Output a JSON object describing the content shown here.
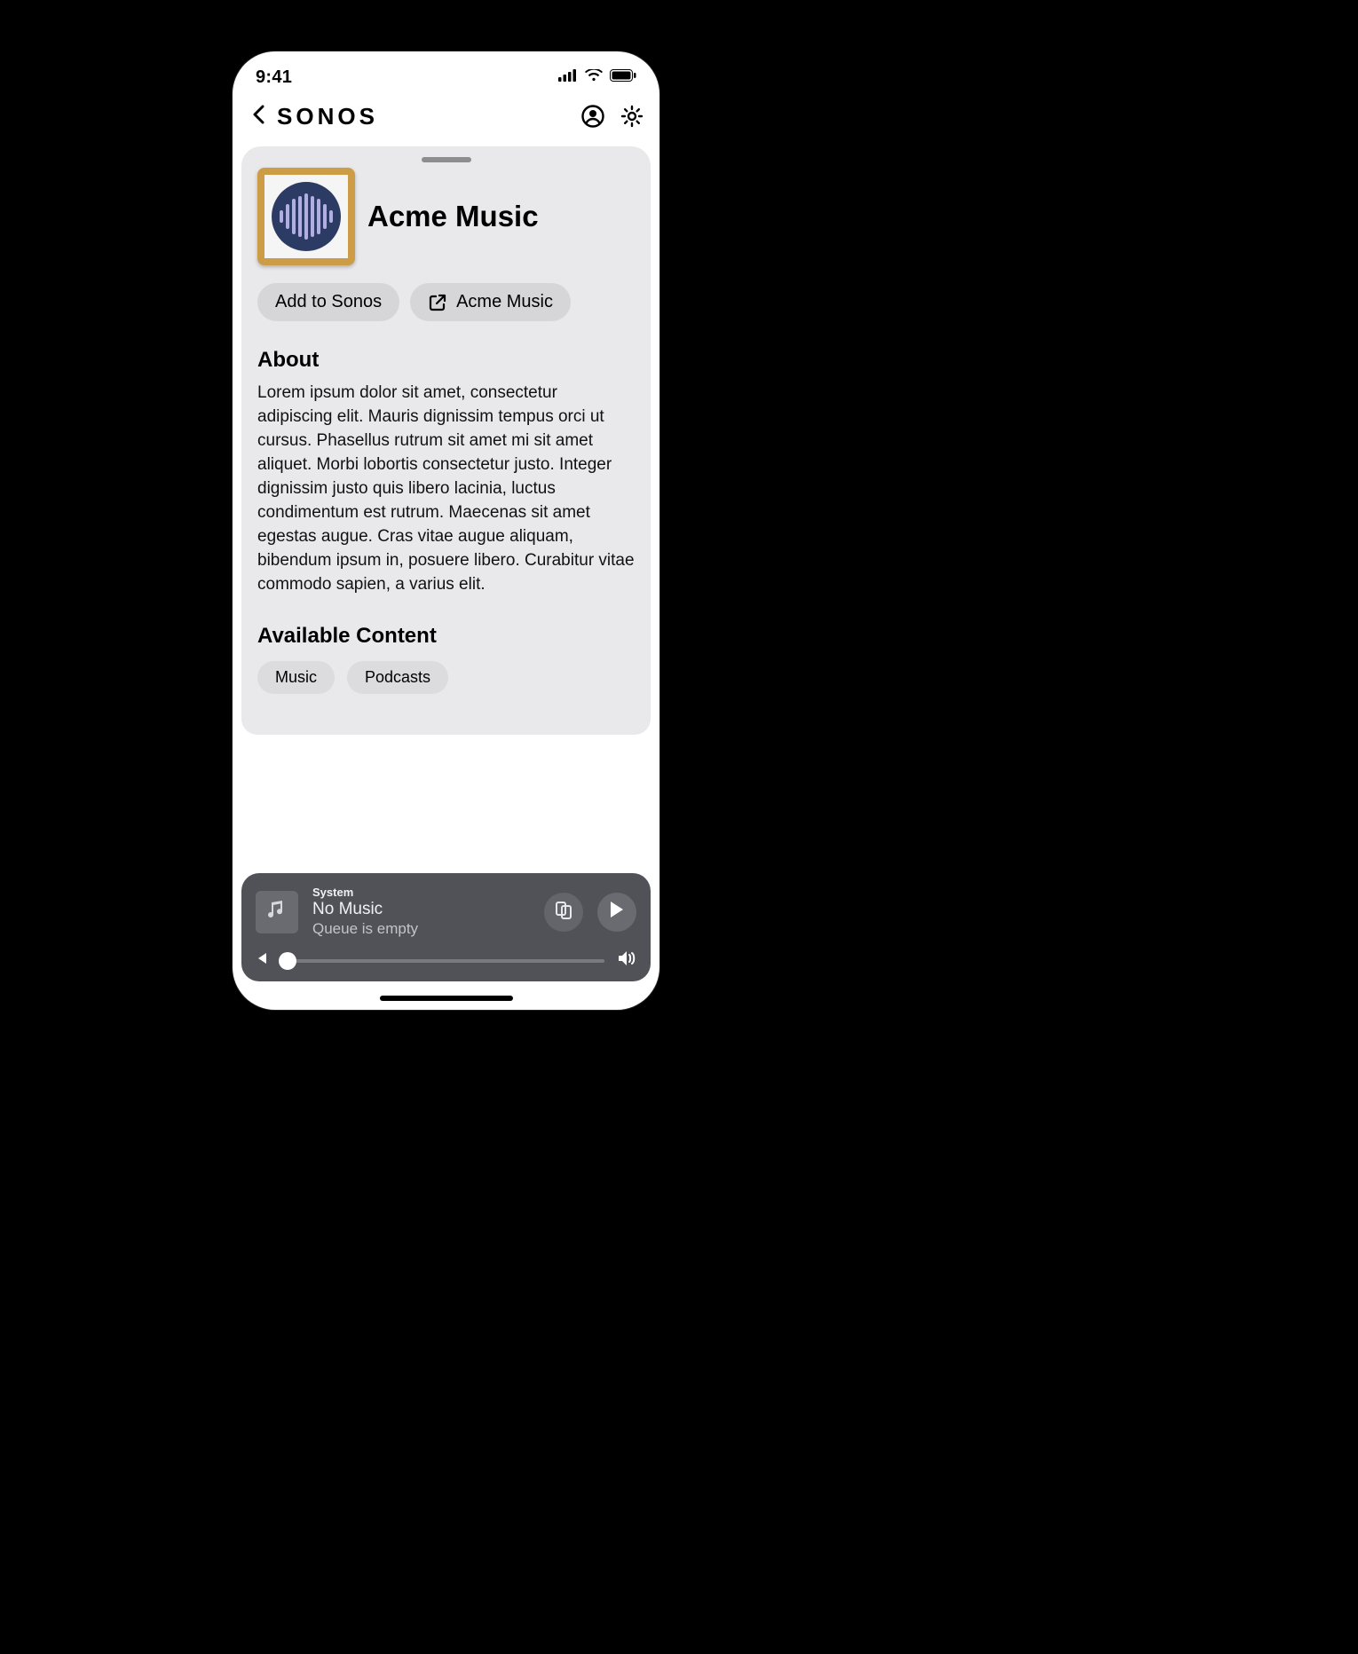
{
  "statusbar": {
    "time": "9:41"
  },
  "navbar": {
    "title": "SONOS"
  },
  "service": {
    "name": "Acme Music",
    "actions": {
      "add_label": "Add to Sonos",
      "open_label": "Acme Music"
    },
    "about_heading": "About",
    "about_text": "Lorem ipsum dolor sit amet, consectetur adipiscing elit. Mauris dignissim tempus orci ut cursus. Phasellus rutrum sit amet mi sit amet aliquet. Morbi lobortis consectetur justo. Integer dignissim justo quis libero lacinia, luctus condimentum est rutrum. Maecenas sit amet egestas augue. Cras vitae augue aliquam, bibendum ipsum in, posuere libero. Curabitur vitae commodo sapien, a varius elit.",
    "available_heading": "Available Content",
    "content_tags": [
      "Music",
      "Podcasts"
    ]
  },
  "player": {
    "system_label": "System",
    "title": "No Music",
    "subtitle": "Queue is empty"
  }
}
